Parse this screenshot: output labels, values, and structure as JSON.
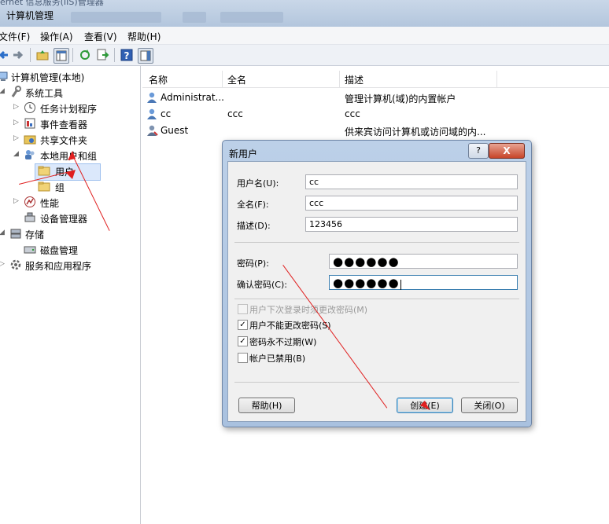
{
  "window": {
    "top_fragment": "ernet 信息服务(IIS)管理器",
    "title": "计算机管理"
  },
  "menu": [
    "文件(F)",
    "操作(A)",
    "查看(V)",
    "帮助(H)"
  ],
  "tree": [
    {
      "label": "计算机管理(本地)",
      "arrow": ""
    },
    {
      "label": "系统工具",
      "arrow": "◢"
    },
    {
      "label": "任务计划程序",
      "arrow": "▷"
    },
    {
      "label": "事件查看器",
      "arrow": "▷"
    },
    {
      "label": "共享文件夹",
      "arrow": "▷"
    },
    {
      "label": "本地用户和组",
      "arrow": "◢"
    },
    {
      "label": "用户",
      "arrow": ""
    },
    {
      "label": "组",
      "arrow": ""
    },
    {
      "label": "性能",
      "arrow": "▷"
    },
    {
      "label": "设备管理器",
      "arrow": ""
    },
    {
      "label": "存储",
      "arrow": "◢"
    },
    {
      "label": "磁盘管理",
      "arrow": ""
    },
    {
      "label": "服务和应用程序",
      "arrow": "▷"
    }
  ],
  "list": {
    "columns": [
      "名称",
      "全名",
      "描述"
    ],
    "rows": [
      {
        "name": "Administrat...",
        "fullname": "",
        "desc": "管理计算机(域)的内置帐户"
      },
      {
        "name": "cc",
        "fullname": "ccc",
        "desc": "ccc"
      },
      {
        "name": "Guest",
        "fullname": "",
        "desc": "供来宾访问计算机或访问域的内..."
      }
    ]
  },
  "dialog": {
    "title": "新用户",
    "help_glyph": "?",
    "close_glyph": "X",
    "fields": {
      "username_label": "用户名(U):",
      "username_value": "cc",
      "fullname_label": "全名(F):",
      "fullname_value": "ccc",
      "desc_label": "描述(D):",
      "desc_value": "123456",
      "password_label": "密码(P):",
      "password_value": "●●●●●●",
      "confirm_label": "确认密码(C):",
      "confirm_value": "●●●●●●"
    },
    "options": [
      {
        "label": "用户下次登录时须更改密码(M)",
        "checked": false,
        "disabled": true
      },
      {
        "label": "用户不能更改密码(S)",
        "checked": true,
        "disabled": false
      },
      {
        "label": "密码永不过期(W)",
        "checked": true,
        "disabled": false
      },
      {
        "label": "帐户已禁用(B)",
        "checked": false,
        "disabled": false
      }
    ],
    "buttons": {
      "help": "帮助(H)",
      "create": "创建(E)",
      "close": "关闭(O)"
    }
  },
  "colors": {
    "annotation": "#e02020",
    "accent": "#3c7fb1"
  }
}
